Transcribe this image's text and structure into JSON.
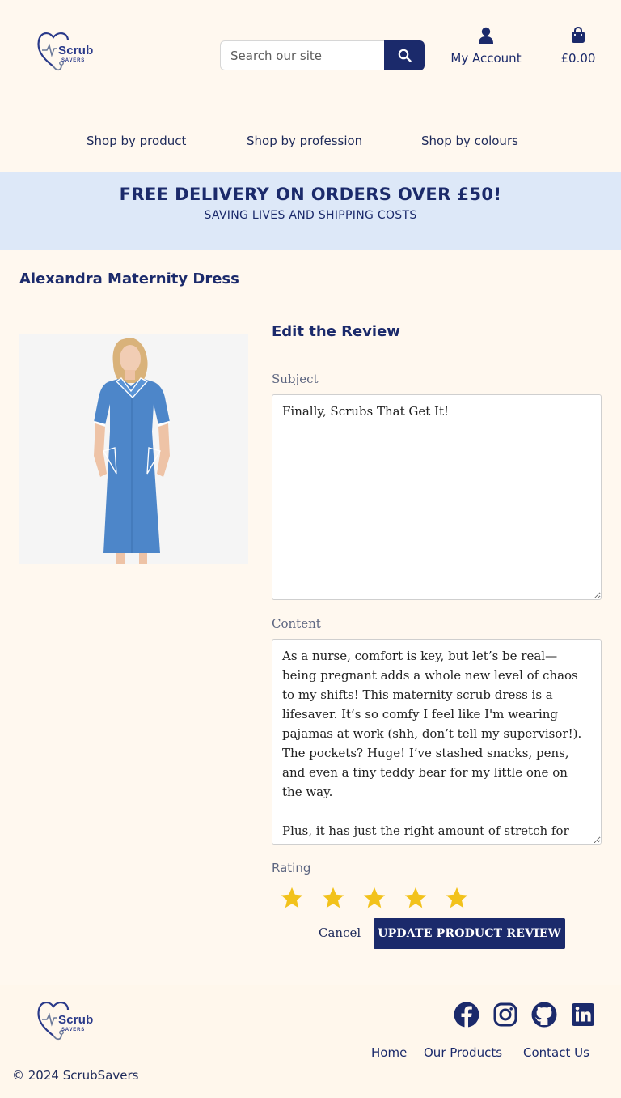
{
  "brand": {
    "name": "Scrub",
    "tagline": "SAVERS"
  },
  "header": {
    "search_placeholder": "Search our site",
    "account_label": "My Account",
    "cart_total": "£0.00"
  },
  "nav": {
    "items": [
      {
        "label": "Shop by product"
      },
      {
        "label": "Shop by profession"
      },
      {
        "label": "Shop by colours"
      }
    ]
  },
  "banner": {
    "headline": "FREE DELIVERY ON ORDERS OVER £50!",
    "subline": "SAVING LIVES AND SHIPPING COSTS"
  },
  "product": {
    "title": "Alexandra Maternity Dress"
  },
  "review_form": {
    "heading": "Edit the Review",
    "subject_label": "Subject",
    "subject_value": "Finally, Scrubs That Get It!",
    "content_label": "Content",
    "content_value": "As a nurse, comfort is key, but let’s be real—being pregnant adds a whole new level of chaos to my shifts! This maternity scrub dress is a lifesaver. It’s so comfy I feel like I'm wearing pajamas at work (shh, don’t tell my supervisor!). The pockets? Huge! I’ve stashed snacks, pens, and even a tiny teddy bear for my little one on the way.\n\nPlus, it has just the right amount of stretch for those unexpected cravings (hello, midnight ice",
    "rating_label": "Rating",
    "rating": 5,
    "rating_max": 5,
    "star_color": "#f2c21b",
    "cancel_label": "Cancel",
    "submit_label": "UPDATE PRODUCT REVIEW"
  },
  "footer": {
    "social": [
      {
        "icon": "facebook-icon"
      },
      {
        "icon": "instagram-icon"
      },
      {
        "icon": "github-icon"
      },
      {
        "icon": "linkedin-icon"
      }
    ],
    "links": [
      {
        "label": "Home"
      },
      {
        "label": "Our Products"
      },
      {
        "label": "Contact Us"
      }
    ],
    "copyright": "© 2024 ScrubSavers"
  },
  "colors": {
    "page_bg": "#fff8ef",
    "primary": "#1b2a6b",
    "banner_bg": "#dde8f8"
  }
}
